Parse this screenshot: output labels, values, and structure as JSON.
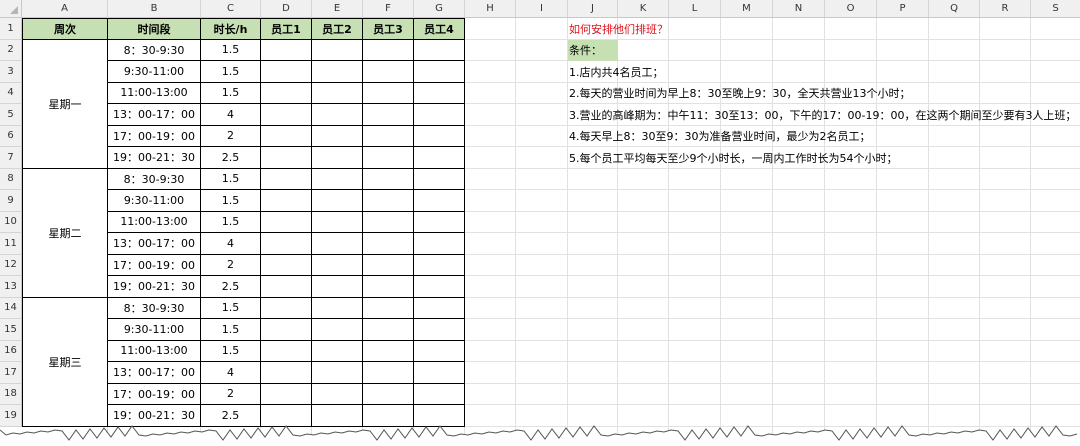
{
  "columns": [
    "A",
    "B",
    "C",
    "D",
    "E",
    "F",
    "G",
    "H",
    "I",
    "J",
    "K",
    "L",
    "M",
    "N",
    "O",
    "P",
    "Q",
    "R",
    "S"
  ],
  "rows": [
    "1",
    "2",
    "3",
    "4",
    "5",
    "6",
    "7",
    "8",
    "9",
    "10",
    "11",
    "12",
    "13",
    "14",
    "15",
    "16",
    "17",
    "18",
    "19"
  ],
  "header": {
    "week": "周次",
    "slot": "时间段",
    "duration": "时长/h",
    "staff": [
      "员工1",
      "员工2",
      "员工3",
      "员工4"
    ]
  },
  "days": [
    "星期一",
    "星期二",
    "星期三"
  ],
  "slots": [
    {
      "time": "8：30-9:30",
      "hours": "1.5"
    },
    {
      "time": "9:30-11:00",
      "hours": "1.5"
    },
    {
      "time": "11:00-13:00",
      "hours": "1.5"
    },
    {
      "time": "13：00-17：00",
      "hours": "4"
    },
    {
      "time": "17：00-19：00",
      "hours": "2"
    },
    {
      "time": "19：00-21：30",
      "hours": "2.5"
    }
  ],
  "question": "如何安排他们排班？",
  "conditions": {
    "label": "条件：",
    "items": [
      "1.店内共4名员工；",
      "2.每天的营业时间为早上8：30至晚上9：30，全天共营业13个小时；",
      "3.营业的高峰期为：中午11：30至13：00，下午的17：00-19：00，在这两个期间至少要有3人上班；",
      "4.每天早上8：30至9：30为准备营业时间，最少为2名员工；",
      "5.每个员工平均每天至少9个小时长，一周内工作时长为54个小时；"
    ]
  },
  "colors": {
    "header_fill": "#c6e0b4",
    "question_text": "#e0111b",
    "cell_border": "#000000",
    "gridline": "#e1e1e1"
  }
}
